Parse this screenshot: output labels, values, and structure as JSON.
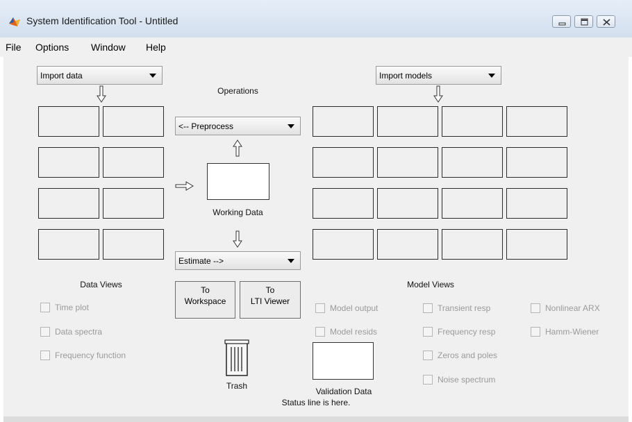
{
  "window": {
    "title": "System Identification Tool - Untitled",
    "controls": [
      "minimize",
      "maximize",
      "close"
    ]
  },
  "menu": [
    "File",
    "Options",
    "Window",
    "Help"
  ],
  "left": {
    "import_data": "Import data",
    "data_views_label": "Data Views",
    "checkboxes": [
      "Time plot",
      "Data spectra",
      "Frequency function"
    ]
  },
  "center": {
    "operations_label": "Operations",
    "preprocess": "<-- Preprocess",
    "working_data_label": "Working Data",
    "estimate": "Estimate -->",
    "to_workspace": [
      "To",
      "Workspace"
    ],
    "to_lti_viewer": [
      "To",
      "LTI Viewer"
    ],
    "trash_label": "Trash",
    "validation_data_label": "Validation Data",
    "status_line": "Status line is here."
  },
  "right": {
    "import_models": "Import models",
    "model_views_label": "Model Views",
    "checkboxes_col1": [
      "Model output",
      "Model resids"
    ],
    "checkboxes_col2": [
      "Transient resp",
      "Frequency resp",
      "Zeros and poles",
      "Noise spectrum"
    ],
    "checkboxes_col3": [
      "Nonlinear ARX",
      "Hamm-Wiener"
    ]
  },
  "icons": {
    "app": "matlab-membrane-icon",
    "trash": "trash-can-icon",
    "arrows": "arrow-icon"
  },
  "colors": {
    "titlebar": "#d8e4f1",
    "client": "#f0f0f0",
    "disabled_text": "#9a9a9a"
  }
}
